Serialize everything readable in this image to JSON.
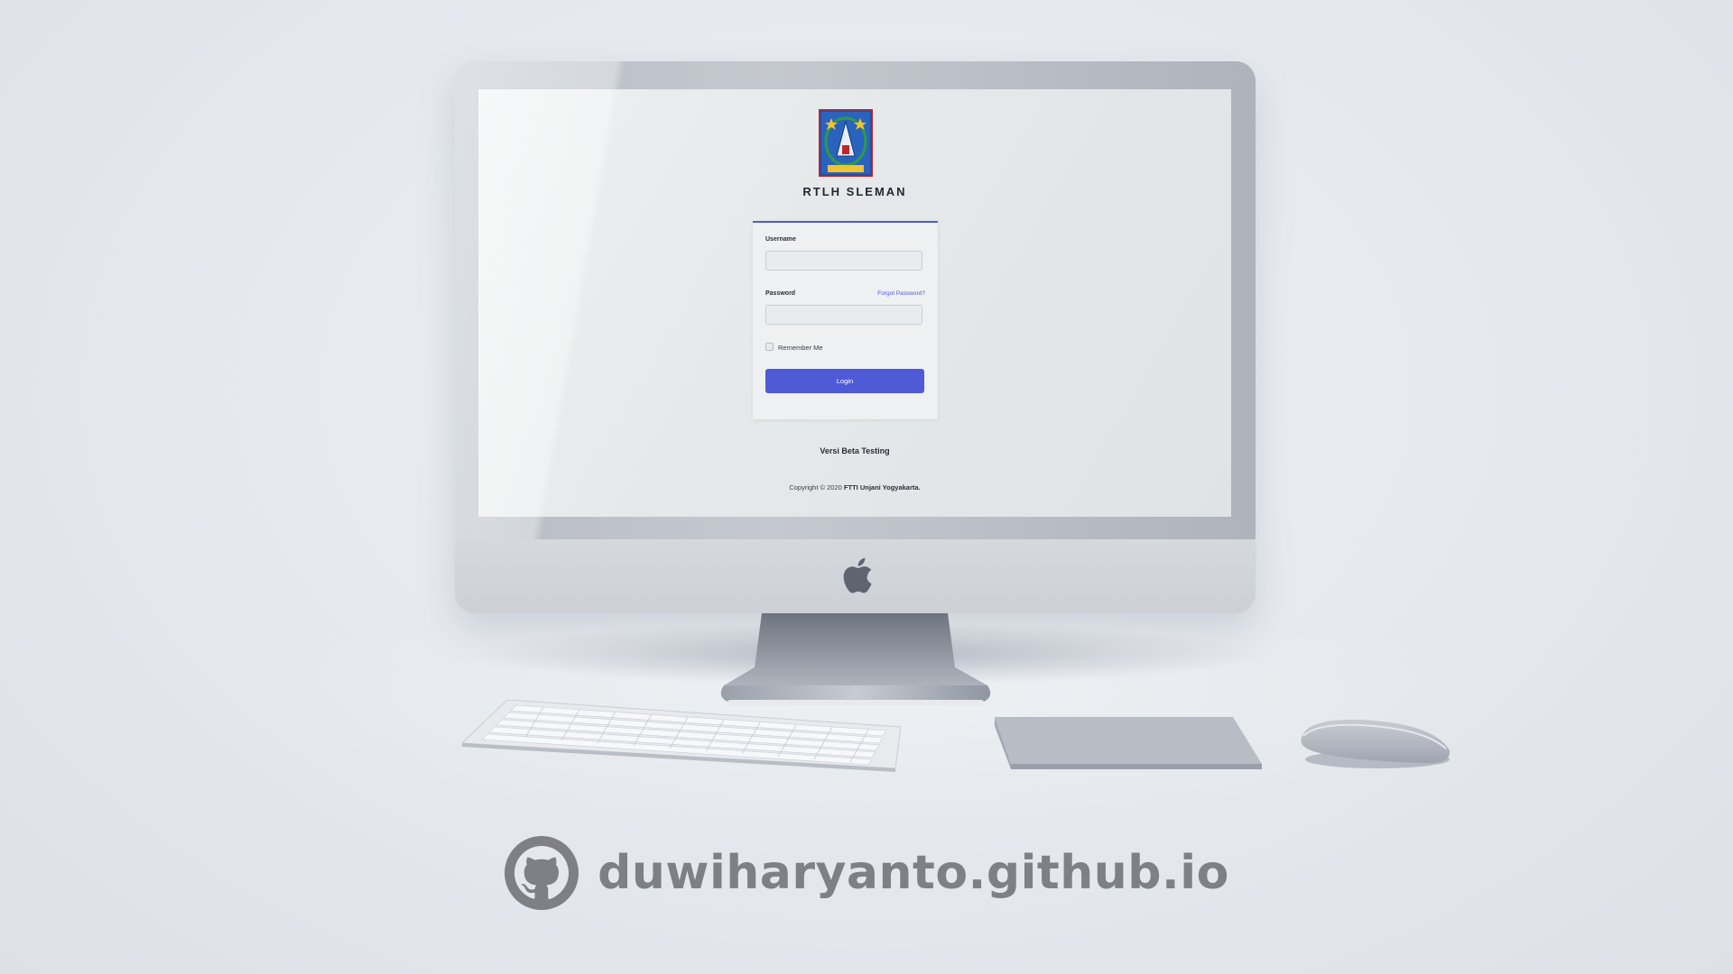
{
  "app": {
    "title": "RTLH SLEMAN",
    "logo_text": "SLEMAN"
  },
  "login_form": {
    "username_label": "Username",
    "username_value": "",
    "password_label": "Password",
    "password_value": "",
    "forgot_password_label": "Forgot Password?",
    "remember_label": "Remember Me",
    "remember_checked": false,
    "login_label": "Login"
  },
  "footer_text": {
    "version": "Versi Beta Testing",
    "copyright_prefix": "Copyright © 2020",
    "copyright_owner": "FTTI Unjani Yogyakarta."
  },
  "watermark": {
    "url": "duwiharyanto.github.io",
    "icon": "github-icon"
  },
  "colors": {
    "accent": "#4e5ad6",
    "watermark": "#7e8085"
  }
}
